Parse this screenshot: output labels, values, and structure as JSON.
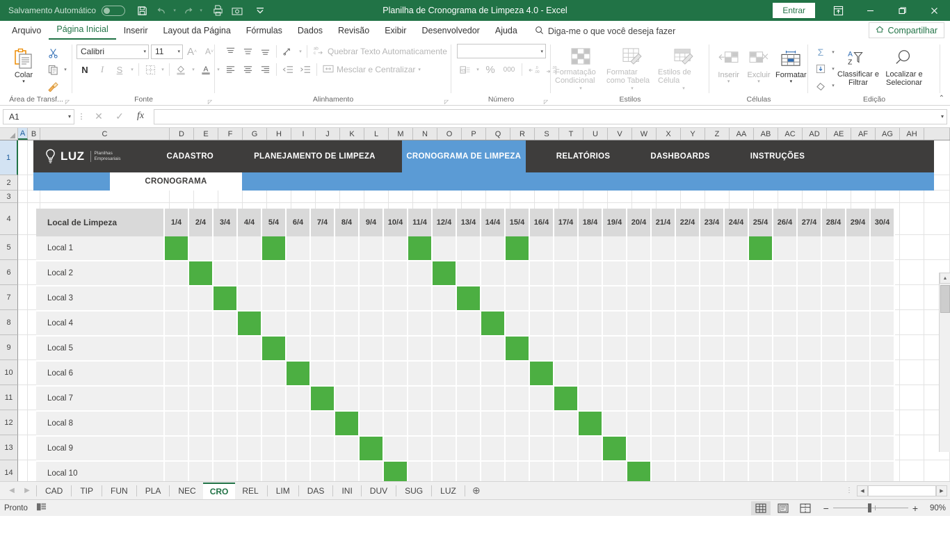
{
  "titlebar": {
    "autosave_label": "Salvamento Automático",
    "autosave_state": "off",
    "document_title": "Planilha de Cronograma de Limpeza 4.0  -  Excel",
    "signin_label": "Entrar",
    "qat_icons": [
      "save-icon",
      "undo-icon",
      "redo-icon",
      "quick-print-icon",
      "camera-icon",
      "customize-qat-icon"
    ],
    "window_buttons": [
      "ribbon-display-options",
      "minimize",
      "restore",
      "close"
    ]
  },
  "ribbon": {
    "tabs": [
      {
        "label": "Arquivo",
        "active": false
      },
      {
        "label": "Página Inicial",
        "active": true
      },
      {
        "label": "Inserir",
        "active": false
      },
      {
        "label": "Layout da Página",
        "active": false
      },
      {
        "label": "Fórmulas",
        "active": false
      },
      {
        "label": "Dados",
        "active": false
      },
      {
        "label": "Revisão",
        "active": false
      },
      {
        "label": "Exibir",
        "active": false
      },
      {
        "label": "Desenvolvedor",
        "active": false
      },
      {
        "label": "Ajuda",
        "active": false
      }
    ],
    "tellme_placeholder": "Diga-me o que você deseja fazer",
    "share_label": "Compartilhar",
    "groups": {
      "clipboard": {
        "label": "Área de Transf...",
        "paste_label": "Colar",
        "cut_tip": "Recortar",
        "copy_tip": "Copiar",
        "format_painter_tip": "Pincel de Formatação"
      },
      "font": {
        "label": "Fonte",
        "font_name": "Calibri",
        "font_size": "11",
        "grow_label": "A",
        "shrink_label": "A",
        "bold_label": "N",
        "italic_label": "I",
        "underline_label": "S"
      },
      "alignment": {
        "label": "Alinhamento",
        "wrap_text_label": "Quebrar Texto Automaticamente",
        "merge_label": "Mesclar e Centralizar"
      },
      "number": {
        "label": "Número",
        "format_value": "",
        "percent_label": "%",
        "comma_label": "000"
      },
      "styles": {
        "label": "Estilos",
        "conditional_label": "Formatação Condicional",
        "table_label": "Formatar como Tabela",
        "cell_label": "Estilos de Célula"
      },
      "cells": {
        "label": "Células",
        "insert_label": "Inserir",
        "delete_label": "Excluir",
        "format_label": "Formatar"
      },
      "editing": {
        "label": "Edição",
        "sort_label": "Classificar e Filtrar",
        "find_label": "Localizar e Selecionar"
      }
    }
  },
  "formula_bar": {
    "name_box": "A1",
    "cancel_icon": "close-icon",
    "confirm_icon": "check-icon",
    "function_icon": "fx-icon",
    "formula_value": ""
  },
  "grid": {
    "columns": [
      "A",
      "B",
      "C",
      "D",
      "E",
      "F",
      "G",
      "H",
      "I",
      "J",
      "K",
      "L",
      "M",
      "N",
      "O",
      "P",
      "Q",
      "R",
      "S",
      "T",
      "U",
      "V",
      "W",
      "X",
      "Y",
      "Z",
      "AA",
      "AB",
      "AC",
      "AD",
      "AE",
      "AF",
      "AG",
      "AH"
    ],
    "selected_column": "A",
    "rows": [
      "1",
      "2",
      "3",
      "4",
      "5",
      "6",
      "7",
      "8",
      "9",
      "10",
      "11",
      "12",
      "13",
      "14"
    ],
    "selected_row": "1",
    "active_cell": "A1"
  },
  "sheet": {
    "logo_text": "LUZ",
    "logo_sub_line1": "Planilhas",
    "logo_sub_line2": "Empresariais",
    "nav_items": [
      {
        "label": "CADASTRO",
        "active": false
      },
      {
        "label": "PLANEJAMENTO DE LIMPEZA",
        "active": false
      },
      {
        "label": "CRONOGRAMA DE LIMPEZA",
        "active": true
      },
      {
        "label": "RELATÓRIOS",
        "active": false
      },
      {
        "label": "DASHBOARDS",
        "active": false
      },
      {
        "label": "INSTRUÇÕES",
        "active": false
      }
    ],
    "subtab_label": "CRONOGRAMA",
    "table": {
      "first_header": "Local de Limpeza",
      "date_headers": [
        "1/4",
        "2/4",
        "3/4",
        "4/4",
        "5/4",
        "6/4",
        "7/4",
        "8/4",
        "9/4",
        "10/4",
        "11/4",
        "12/4",
        "13/4",
        "14/4",
        "15/4",
        "16/4",
        "17/4",
        "18/4",
        "19/4",
        "20/4",
        "21/4",
        "22/4",
        "23/4",
        "24/4",
        "25/4",
        "26/4",
        "27/4",
        "28/4",
        "29/4",
        "30/4"
      ],
      "rows": [
        {
          "name": "Local 1",
          "marks": [
            1,
            0,
            0,
            0,
            1,
            0,
            0,
            0,
            0,
            0,
            1,
            0,
            0,
            0,
            1,
            0,
            0,
            0,
            0,
            0,
            0,
            0,
            0,
            0,
            1,
            0,
            0,
            0,
            0,
            0
          ]
        },
        {
          "name": "Local 2",
          "marks": [
            0,
            1,
            0,
            0,
            0,
            0,
            0,
            0,
            0,
            0,
            0,
            1,
            0,
            0,
            0,
            0,
            0,
            0,
            0,
            0,
            0,
            0,
            0,
            0,
            0,
            0,
            0,
            0,
            0,
            0
          ]
        },
        {
          "name": "Local 3",
          "marks": [
            0,
            0,
            1,
            0,
            0,
            0,
            0,
            0,
            0,
            0,
            0,
            0,
            1,
            0,
            0,
            0,
            0,
            0,
            0,
            0,
            0,
            0,
            0,
            0,
            0,
            0,
            0,
            0,
            0,
            0
          ]
        },
        {
          "name": "Local 4",
          "marks": [
            0,
            0,
            0,
            1,
            0,
            0,
            0,
            0,
            0,
            0,
            0,
            0,
            0,
            1,
            0,
            0,
            0,
            0,
            0,
            0,
            0,
            0,
            0,
            0,
            0,
            0,
            0,
            0,
            0,
            0
          ]
        },
        {
          "name": "Local 5",
          "marks": [
            0,
            0,
            0,
            0,
            1,
            0,
            0,
            0,
            0,
            0,
            0,
            0,
            0,
            0,
            1,
            0,
            0,
            0,
            0,
            0,
            0,
            0,
            0,
            0,
            0,
            0,
            0,
            0,
            0,
            0
          ]
        },
        {
          "name": "Local 6",
          "marks": [
            0,
            0,
            0,
            0,
            0,
            1,
            0,
            0,
            0,
            0,
            0,
            0,
            0,
            0,
            0,
            1,
            0,
            0,
            0,
            0,
            0,
            0,
            0,
            0,
            0,
            0,
            0,
            0,
            0,
            0
          ]
        },
        {
          "name": "Local 7",
          "marks": [
            0,
            0,
            0,
            0,
            0,
            0,
            1,
            0,
            0,
            0,
            0,
            0,
            0,
            0,
            0,
            0,
            1,
            0,
            0,
            0,
            0,
            0,
            0,
            0,
            0,
            0,
            0,
            0,
            0,
            0
          ]
        },
        {
          "name": "Local 8",
          "marks": [
            0,
            0,
            0,
            0,
            0,
            0,
            0,
            1,
            0,
            0,
            0,
            0,
            0,
            0,
            0,
            0,
            0,
            1,
            0,
            0,
            0,
            0,
            0,
            0,
            0,
            0,
            0,
            0,
            0,
            0
          ]
        },
        {
          "name": "Local 9",
          "marks": [
            0,
            0,
            0,
            0,
            0,
            0,
            0,
            0,
            1,
            0,
            0,
            0,
            0,
            0,
            0,
            0,
            0,
            0,
            1,
            0,
            0,
            0,
            0,
            0,
            0,
            0,
            0,
            0,
            0,
            0
          ]
        },
        {
          "name": "Local 10",
          "marks": [
            0,
            0,
            0,
            0,
            0,
            0,
            0,
            0,
            0,
            1,
            0,
            0,
            0,
            0,
            0,
            0,
            0,
            0,
            0,
            1,
            0,
            0,
            0,
            0,
            0,
            0,
            0,
            0,
            0,
            0
          ]
        }
      ]
    },
    "colors": {
      "nav_bg": "#3e3d3c",
      "nav_active": "#5b9bd5",
      "header_bg": "#d9d9d9",
      "cell_bg": "#f0f0f0",
      "mark_green": "#4caf42"
    }
  },
  "sheet_tabs": {
    "items": [
      {
        "label": "CAD",
        "active": false
      },
      {
        "label": "TIP",
        "active": false
      },
      {
        "label": "FUN",
        "active": false
      },
      {
        "label": "PLA",
        "active": false
      },
      {
        "label": "NEC",
        "active": false
      },
      {
        "label": "CRO",
        "active": true
      },
      {
        "label": "REL",
        "active": false
      },
      {
        "label": "LIM",
        "active": false
      },
      {
        "label": "DAS",
        "active": false
      },
      {
        "label": "INI",
        "active": false
      },
      {
        "label": "DUV",
        "active": false
      },
      {
        "label": "SUG",
        "active": false
      },
      {
        "label": "LUZ",
        "active": false
      }
    ],
    "add_label": "+"
  },
  "status_bar": {
    "status_text": "Pronto",
    "accessibility_icon": "accessibility-icon",
    "views": [
      "normal-view",
      "page-layout-view",
      "page-break-view"
    ],
    "active_view": "normal-view",
    "zoom_out_label": "−",
    "zoom_in_label": "+",
    "zoom_level": "90%"
  }
}
